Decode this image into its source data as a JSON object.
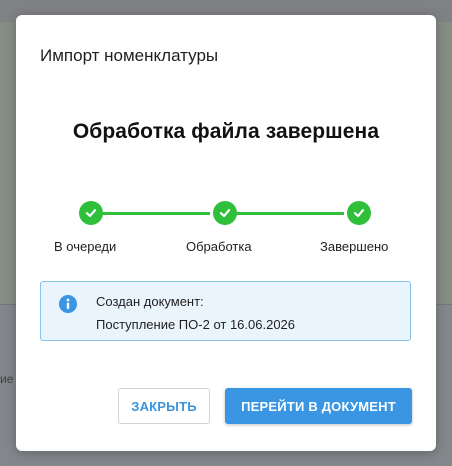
{
  "background": {
    "fragment_text": "ие"
  },
  "dialog": {
    "title": "Импорт номенклатуры",
    "status_heading": "Обработка файла завершена",
    "steps": [
      {
        "label": "В очереди",
        "state": "done"
      },
      {
        "label": "Обработка",
        "state": "done"
      },
      {
        "label": "Завершено",
        "state": "done"
      }
    ],
    "notice": {
      "icon": "info-icon",
      "line1": "Создан документ:",
      "line2": "Поступление ПО-2 от 16.06.2026"
    },
    "buttons": {
      "close_label": "ЗАКРЫТЬ",
      "go_label": "ПЕРЕЙТИ В ДОКУМЕНТ"
    }
  },
  "colors": {
    "success": "#2fbf3a",
    "accent": "#3a95e3",
    "info_bg": "#eaf4fd",
    "info_border": "#88c2ee"
  }
}
